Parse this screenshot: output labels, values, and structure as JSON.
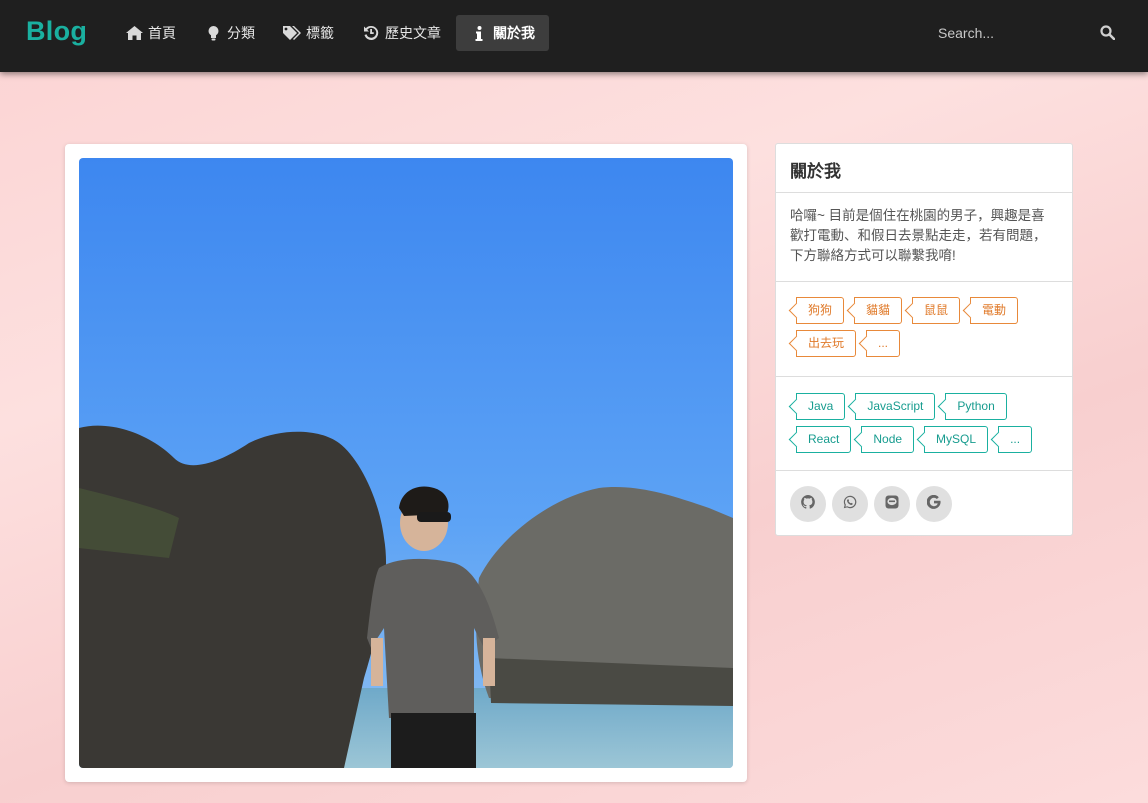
{
  "navbar": {
    "brand": "Blog",
    "items": [
      {
        "label": "首頁",
        "icon": "home-icon",
        "active": false
      },
      {
        "label": "分類",
        "icon": "lightbulb-icon",
        "active": false
      },
      {
        "label": "標籤",
        "icon": "tags-icon",
        "active": false
      },
      {
        "label": "歷史文章",
        "icon": "history-icon",
        "active": false
      },
      {
        "label": "關於我",
        "icon": "info-icon",
        "active": true
      }
    ],
    "search_placeholder": "Search...",
    "search_icon": "search-icon"
  },
  "main": {
    "photo_alt": "profile-photo"
  },
  "sidebar": {
    "title": "關於我",
    "description": "哈囉~ 目前是個住在桃園的男子，興趣是喜歡打電動、和假日去景點走走，若有問題，下方聯絡方式可以聯繫我唷!",
    "hobbies": [
      "狗狗",
      "貓貓",
      "鼠鼠",
      "電動",
      "出去玩",
      "..."
    ],
    "skills": [
      "Java",
      "JavaScript",
      "Python",
      "React",
      "Node",
      "MySQL",
      "..."
    ],
    "social": [
      {
        "icon": "github-icon"
      },
      {
        "icon": "whatsapp-icon"
      },
      {
        "icon": "line-icon"
      },
      {
        "icon": "google-icon"
      }
    ]
  },
  "colors": {
    "brand": "#1ab0a0",
    "navbar_bg": "#1f1f1f",
    "hobby_tag": "#e8893a",
    "skill_tag": "#1ab0a0",
    "page_bg": "#fbd3d3"
  }
}
